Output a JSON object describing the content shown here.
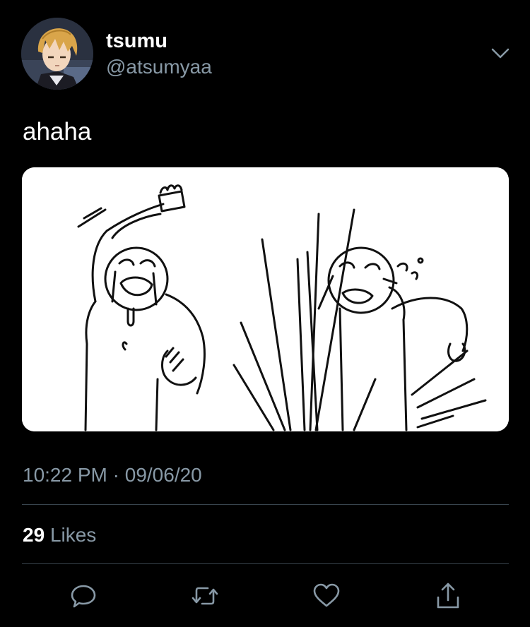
{
  "author": {
    "display_name": "tsumu",
    "handle": "@atsumyaa",
    "avatar_icon": "profile-avatar"
  },
  "tweet": {
    "text": "ahaha",
    "media_description_icon": "comic-image",
    "time": "10:22 PM",
    "separator": "·",
    "date": "09/06/20"
  },
  "stats": {
    "likes_count": "29",
    "likes_label": "Likes"
  },
  "actions": {
    "reply_icon": "reply-icon",
    "retweet_icon": "retweet-icon",
    "like_icon": "heart-icon",
    "share_icon": "share-icon"
  },
  "colors": {
    "background": "#000000",
    "primary_text": "#ffffff",
    "secondary_text": "#8899a6",
    "divider": "#38444d"
  }
}
